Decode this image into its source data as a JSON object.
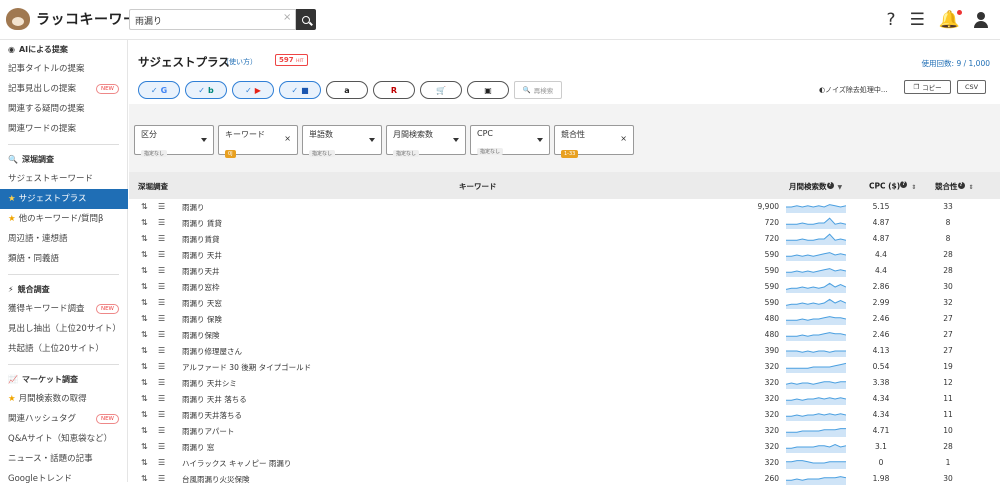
{
  "app": {
    "logo_text": "ラッコキーワード"
  },
  "search": {
    "value": "雨漏り",
    "clear_icon": "×"
  },
  "sidebar": {
    "sections": [
      {
        "title": "AIによる提案",
        "icon": "robot-icon",
        "items": [
          {
            "label": "記事タイトルの提案"
          },
          {
            "label": "記事見出しの提案",
            "badge": "NEW"
          },
          {
            "label": "関連する疑問の提案"
          },
          {
            "label": "関連ワードの提案"
          }
        ]
      },
      {
        "title": "深堀調査",
        "icon": "search-icon",
        "items": [
          {
            "label": "サジェストキーワード"
          },
          {
            "label": "サジェストプラス",
            "active": true,
            "star": true
          },
          {
            "label": "他のキーワード/質問β",
            "star": true
          },
          {
            "label": "周辺語・連想語"
          },
          {
            "label": "類語・同義語"
          }
        ]
      },
      {
        "title": "競合調査",
        "icon": "bolt-icon",
        "items": [
          {
            "label": "獲得キーワード調査",
            "badge": "NEW"
          },
          {
            "label": "見出し抽出（上位20サイト）"
          },
          {
            "label": "共起語（上位20サイト）"
          }
        ]
      },
      {
        "title": "マーケット調査",
        "icon": "chart-icon",
        "items": [
          {
            "label": "月間検索数の取得",
            "star": true
          },
          {
            "label": "関連ハッシュタグ",
            "badge": "NEW"
          },
          {
            "label": "Q&Aサイト（知恵袋など）"
          },
          {
            "label": "ニュース・話題の記事"
          },
          {
            "label": "Googleトレンド"
          }
        ]
      }
    ]
  },
  "header": {
    "title": "サジェストプラス",
    "howto": "（使い方）",
    "hit_count": "597",
    "hit_unit": "HIT",
    "usage": "使用回数: 9 / 1,000",
    "research_label": "再検索",
    "noise": "ノイズ除去処理中...",
    "copy_label": "コピー",
    "csv_label": "CSV"
  },
  "engines": [
    {
      "name": "google",
      "glyph": "G",
      "color": "#4285f4",
      "on": true
    },
    {
      "name": "bing",
      "glyph": "b",
      "color": "#00897b",
      "on": true
    },
    {
      "name": "youtube",
      "glyph": "▶",
      "color": "#e62117",
      "on": true
    },
    {
      "name": "video",
      "glyph": "■",
      "color": "#1a56b0",
      "on": true
    },
    {
      "name": "amazon",
      "glyph": "a",
      "color": "#222",
      "on": false
    },
    {
      "name": "rakuten",
      "glyph": "R",
      "color": "#bf0000",
      "on": false
    },
    {
      "name": "shopping",
      "glyph": "🛒",
      "color": "#222",
      "on": false
    },
    {
      "name": "image",
      "glyph": "▣",
      "color": "#222",
      "on": false
    }
  ],
  "filters": [
    {
      "label": "区分",
      "value": "指定なし",
      "kind": "select"
    },
    {
      "label": "キーワード",
      "tag": "0J",
      "kind": "clear"
    },
    {
      "label": "単語数",
      "value": "指定なし",
      "kind": "select"
    },
    {
      "label": "月間検索数",
      "value": "指定なし",
      "kind": "select"
    },
    {
      "label": "CPC",
      "value": "指定なし",
      "kind": "select"
    },
    {
      "label": "競合性",
      "tag": "1-33",
      "kind": "clear"
    }
  ],
  "table": {
    "headers": {
      "dig": "深堀調査",
      "keyword": "キーワード",
      "volume": "月間検索数",
      "cpc": "CPC ($)",
      "comp": "競合性"
    },
    "rows": [
      {
        "kw": "雨漏り",
        "vol": "9,900",
        "cpc": "5.15",
        "comp": "33",
        "trend": [
          5,
          5,
          6,
          5,
          6,
          5,
          6,
          5,
          7,
          6,
          5,
          6
        ]
      },
      {
        "kw": "雨漏り 賃貸",
        "vol": "720",
        "cpc": "4.87",
        "comp": "8",
        "trend": [
          4,
          4,
          4,
          5,
          4,
          4,
          5,
          5,
          9,
          4,
          5,
          4
        ]
      },
      {
        "kw": "雨漏り賃貸",
        "vol": "720",
        "cpc": "4.87",
        "comp": "8",
        "trend": [
          4,
          4,
          4,
          5,
          4,
          4,
          5,
          5,
          9,
          4,
          5,
          4
        ]
      },
      {
        "kw": "雨漏り 天井",
        "vol": "590",
        "cpc": "4.4",
        "comp": "28",
        "trend": [
          4,
          4,
          5,
          4,
          5,
          4,
          5,
          6,
          7,
          5,
          6,
          5
        ]
      },
      {
        "kw": "雨漏り天井",
        "vol": "590",
        "cpc": "4.4",
        "comp": "28",
        "trend": [
          4,
          4,
          5,
          4,
          5,
          4,
          5,
          6,
          7,
          5,
          6,
          5
        ]
      },
      {
        "kw": "雨漏り窓枠",
        "vol": "590",
        "cpc": "2.86",
        "comp": "30",
        "trend": [
          3,
          4,
          4,
          5,
          4,
          5,
          4,
          5,
          8,
          5,
          7,
          5
        ]
      },
      {
        "kw": "雨漏り 天窓",
        "vol": "590",
        "cpc": "2.99",
        "comp": "32",
        "trend": [
          3,
          4,
          4,
          5,
          4,
          5,
          4,
          5,
          8,
          5,
          7,
          5
        ]
      },
      {
        "kw": "雨漏り 保険",
        "vol": "480",
        "cpc": "2.46",
        "comp": "27",
        "trend": [
          4,
          4,
          4,
          5,
          4,
          5,
          5,
          6,
          7,
          6,
          6,
          5
        ]
      },
      {
        "kw": "雨漏り保険",
        "vol": "480",
        "cpc": "2.46",
        "comp": "27",
        "trend": [
          4,
          4,
          4,
          5,
          4,
          5,
          5,
          6,
          7,
          6,
          6,
          5
        ]
      },
      {
        "kw": "雨漏り修理屋さん",
        "vol": "390",
        "cpc": "4.13",
        "comp": "27",
        "trend": [
          5,
          5,
          5,
          4,
          5,
          4,
          5,
          5,
          4,
          5,
          5,
          5
        ]
      },
      {
        "kw": "アルファード 30 後期 タイプゴールド",
        "vol": "320",
        "cpc": "0.54",
        "comp": "19",
        "trend": [
          4,
          4,
          4,
          4,
          4,
          5,
          5,
          5,
          5,
          6,
          7,
          8
        ]
      },
      {
        "kw": "雨漏り 天井シミ",
        "vol": "320",
        "cpc": "3.38",
        "comp": "12",
        "trend": [
          4,
          5,
          4,
          5,
          5,
          4,
          5,
          6,
          6,
          5,
          6,
          6
        ]
      },
      {
        "kw": "雨漏り 天井 落ちる",
        "vol": "320",
        "cpc": "4.34",
        "comp": "11",
        "trend": [
          4,
          4,
          5,
          4,
          5,
          5,
          6,
          5,
          6,
          5,
          6,
          5
        ]
      },
      {
        "kw": "雨漏り天井落ちる",
        "vol": "320",
        "cpc": "4.34",
        "comp": "11",
        "trend": [
          4,
          4,
          5,
          4,
          5,
          5,
          6,
          5,
          6,
          5,
          6,
          5
        ]
      },
      {
        "kw": "雨漏りアパート",
        "vol": "320",
        "cpc": "4.71",
        "comp": "10",
        "trend": [
          4,
          4,
          4,
          5,
          5,
          5,
          5,
          6,
          6,
          6,
          7,
          7
        ]
      },
      {
        "kw": "雨漏り 窓",
        "vol": "320",
        "cpc": "3.1",
        "comp": "28",
        "trend": [
          4,
          4,
          5,
          5,
          5,
          5,
          6,
          6,
          5,
          7,
          5,
          6
        ]
      },
      {
        "kw": "ハイラックス キャノピー 雨漏り",
        "vol": "320",
        "cpc": "0",
        "comp": "1",
        "trend": [
          6,
          6,
          7,
          7,
          6,
          5,
          5,
          5,
          6,
          6,
          6,
          6
        ]
      },
      {
        "kw": "台風雨漏り火災保険",
        "vol": "260",
        "cpc": "1.98",
        "comp": "30",
        "trend": [
          4,
          4,
          5,
          4,
          5,
          5,
          5,
          6,
          6,
          6,
          7,
          6
        ]
      }
    ]
  },
  "colors": {
    "accent": "#1f6eb5",
    "hit": "#e44444",
    "tag": "#e8a020",
    "spark": "#4a9fe0"
  }
}
